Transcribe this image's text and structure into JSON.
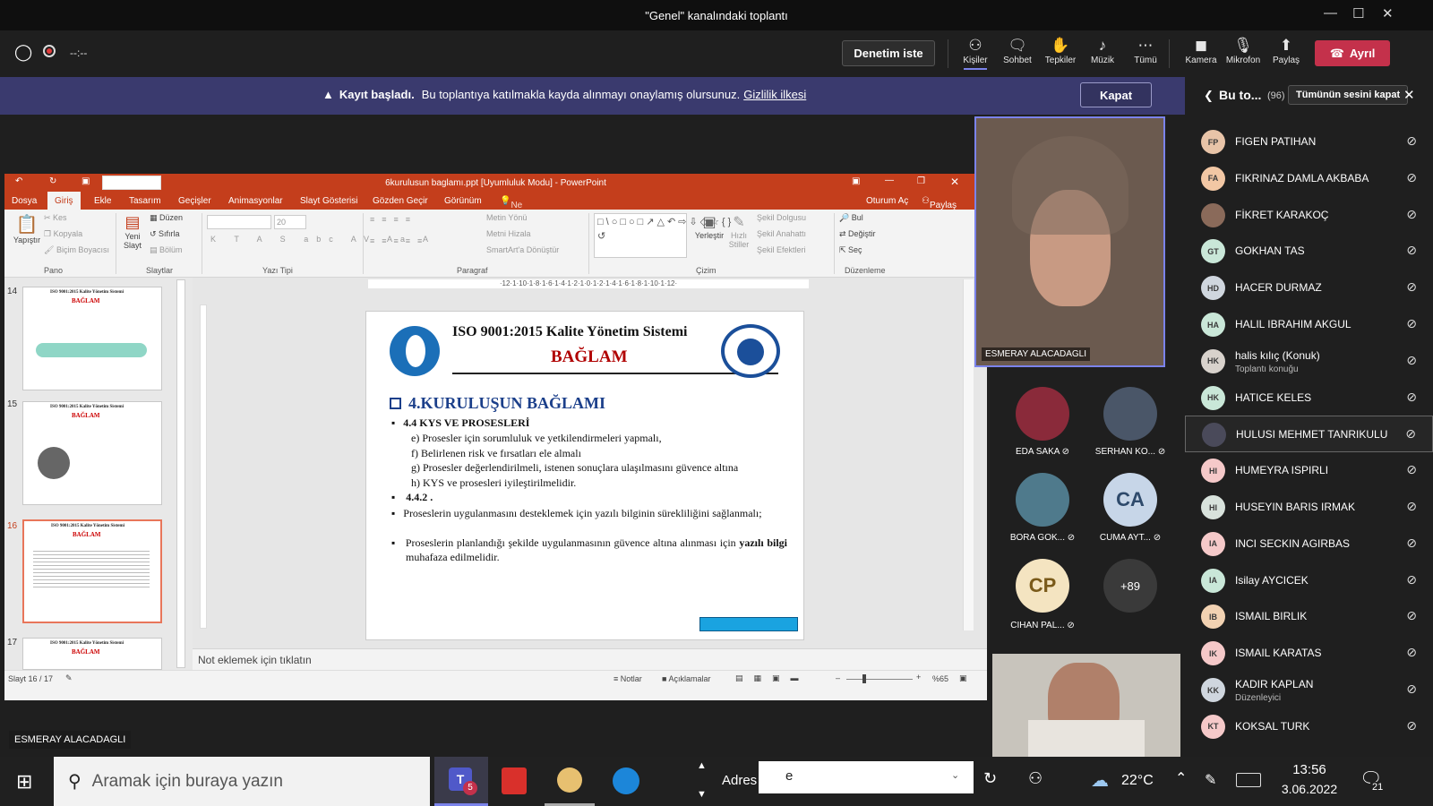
{
  "window": {
    "title": "\"Genel\" kanalındaki toplantı"
  },
  "toolbar": {
    "timer": "--:--",
    "request_control": "Denetim iste",
    "buttons": [
      {
        "label": "Kişiler",
        "icon": "people-icon"
      },
      {
        "label": "Sohbet",
        "icon": "chat-icon"
      },
      {
        "label": "Tepkiler",
        "icon": "reactions-icon"
      },
      {
        "label": "Müzik",
        "icon": "music-icon"
      },
      {
        "label": "Tümü",
        "icon": "more-icon"
      },
      {
        "label": "Kamera",
        "icon": "camera-icon"
      },
      {
        "label": "Mikrofon",
        "icon": "mic-off-icon"
      },
      {
        "label": "Paylaş",
        "icon": "share-icon"
      }
    ],
    "leave": "Ayrıl"
  },
  "banner": {
    "bold": "Kayıt başladı.",
    "text": "Bu toplantıya katılmakla kayda alınmayı onaylamış olursunuz.",
    "link": "Gizlilik ilkesi",
    "close": "Kapat"
  },
  "presenter_label": "ESMERAY ALACADAGLI",
  "powerpoint": {
    "title": "6kurulusun baglamı.ppt [Uyumluluk Modu] - PowerPoint",
    "tabs": [
      "Dosya",
      "Giriş",
      "Ekle",
      "Tasarım",
      "Geçişler",
      "Animasyonlar",
      "Slayt Gösterisi",
      "Gözden Geçir",
      "Görünüm"
    ],
    "tell_me": "Ne yapmak istediğinizi söyleyin...",
    "sign_in": "Oturum Aç",
    "share": "Paylaş",
    "ribbon": {
      "pano": {
        "paste": "Yapıştır",
        "cut": "Kes",
        "copy": "Kopyala",
        "painter": "Biçim Boyacısı",
        "group": "Pano"
      },
      "slides": {
        "new": "Yeni Slayt",
        "layout": "Düzen",
        "reset": "Sıfırla",
        "section": "Bölüm",
        "group": "Slaytlar"
      },
      "font": {
        "size": "20",
        "group": "Yazı Tipi"
      },
      "paragraph": {
        "dir": "Metin Yönü",
        "align": "Metni Hizala",
        "smartart": "SmartArt'a Dönüştür",
        "group": "Paragraf"
      },
      "drawing": {
        "arrange": "Yerleştir",
        "quick": "Hızlı Stiller",
        "fill": "Şekil Dolgusu",
        "outline": "Şekil Anahattı",
        "effects": "Şekil Efektleri",
        "group": "Çizim"
      },
      "editing": {
        "find": "Bul",
        "replace": "Değiştir",
        "select": "Seç",
        "group": "Düzenleme"
      }
    },
    "thumbnails": [
      {
        "num": "14",
        "title": "ISO 9001:2015 Kalite Yönetim Sistemi",
        "sub": "BAĞLAM"
      },
      {
        "num": "15",
        "title": "ISO 9001:2015 Kalite Yönetim Sistemi",
        "sub": "BAĞLAM"
      },
      {
        "num": "16",
        "title": "ISO 9001:2015 Kalite Yönetim Sistemi",
        "sub": "BAĞLAM"
      },
      {
        "num": "17",
        "title": "ISO 9001:2015 Kalite Yönetim Sistemi",
        "sub": "BAĞLAM"
      }
    ],
    "ruler": "·12·1·10·1·8·1·6·1·4·1·2·1·0·1·2·1·4·1·6·1·8·1·10·1·12·",
    "slide": {
      "title": "ISO 9001:2015 Kalite Yönetim Sistemi",
      "subtitle": "BAĞLAM",
      "heading": "4.KURULUŞUN BAĞLAMI",
      "section1": "4.4 KYS VE PROSESLERİ",
      "items": [
        "e) Prosesler için sorumluluk ve yetkilendirmeleri yapmalı,",
        "f) Belirlenen risk ve fırsatları ele almalı",
        "g) Prosesler değerlendirilmeli, istenen sonuçlara ulaşılmasını güvence altına",
        "h) KYS ve prosesleri iyileştirilmelidir."
      ],
      "section2": "4.4.2 .",
      "bullet1": "Proseslerin uygulanmasını desteklemek için yazılı bilginin sürekliliğini sağlanmalı;",
      "bullet2_a": "Proseslerin planlandığı şekilde uygulanmasının güvence altına alınması için",
      "bullet2_bold": "yazılı bilgi",
      "bullet2_b": "muhafaza edilmelidir."
    },
    "notes_placeholder": "Not eklemek için tıklatın",
    "status": {
      "slide": "Slayt 16 / 17",
      "notes": "Notlar",
      "comments": "Açıklamalar",
      "zoom": "%65"
    }
  },
  "participants_panel": {
    "title": "Bu to...",
    "count": "(96)",
    "mute_all": "Tümünün sesini kapat",
    "people": [
      {
        "initials": "FP",
        "name": "FIGEN PATIHAN",
        "color": "#e8c4a8"
      },
      {
        "initials": "FA",
        "name": "FIKRINAZ DAMLA AKBABA",
        "color": "#f2c7a4"
      },
      {
        "initials": "",
        "name": "FİKRET KARAKOÇ",
        "color": "#8a6a5a"
      },
      {
        "initials": "GT",
        "name": "GOKHAN TAS",
        "color": "#c9e7d8"
      },
      {
        "initials": "HD",
        "name": "HACER DURMAZ",
        "color": "#cfd6de"
      },
      {
        "initials": "HA",
        "name": "HALIL IBRAHIM AKGUL",
        "color": "#c9e7d8"
      },
      {
        "initials": "HK",
        "name": "halis kılıç (Konuk)",
        "sub": "Toplantı konuğu",
        "color": "#d8d2cc"
      },
      {
        "initials": "HK",
        "name": "HATICE KELES",
        "color": "#c9e7d8"
      },
      {
        "initials": "",
        "name": "HULUSI MEHMET TANRIKULU",
        "color": "#4a4a5a"
      },
      {
        "initials": "HI",
        "name": "HUMEYRA ISPIRLI",
        "color": "#f5c9c9"
      },
      {
        "initials": "HI",
        "name": "HUSEYIN BARIS IRMAK",
        "color": "#d8e2dc"
      },
      {
        "initials": "IA",
        "name": "INCI SECKIN AGIRBAS",
        "color": "#f5c9c9"
      },
      {
        "initials": "IA",
        "name": "Isilay AYCICEK",
        "color": "#c9e7d8"
      },
      {
        "initials": "IB",
        "name": "ISMAIL BIRLIK",
        "color": "#f2d2b2"
      },
      {
        "initials": "IK",
        "name": "ISMAIL KARATAS",
        "color": "#f5c9c9"
      },
      {
        "initials": "KK",
        "name": "KADIR KAPLAN",
        "sub": "Düzenleyici",
        "color": "#cfd6de"
      },
      {
        "initials": "KT",
        "name": "KOKSAL TURK",
        "color": "#f5c9c9"
      }
    ]
  },
  "gallery": {
    "speaker": "ESMERAY ALACADAGLI",
    "tiles": [
      {
        "label": "EDA SAKA",
        "initials": ""
      },
      {
        "label": "SERHAN KO...",
        "initials": ""
      },
      {
        "label": "BORA GOK...",
        "initials": ""
      },
      {
        "label": "CUMA AYT...",
        "initials": "CA"
      },
      {
        "label": "CIHAN PAL...",
        "initials": "CP"
      },
      {
        "label": "",
        "initials": "+89"
      }
    ]
  },
  "taskbar": {
    "search_placeholder": "Aramak için buraya yazın",
    "teams_badge": "5",
    "address_label": "Adres",
    "address_value": "e",
    "temperature": "22°C",
    "time": "13:56",
    "date": "3.06.2022",
    "notifications": "21"
  }
}
